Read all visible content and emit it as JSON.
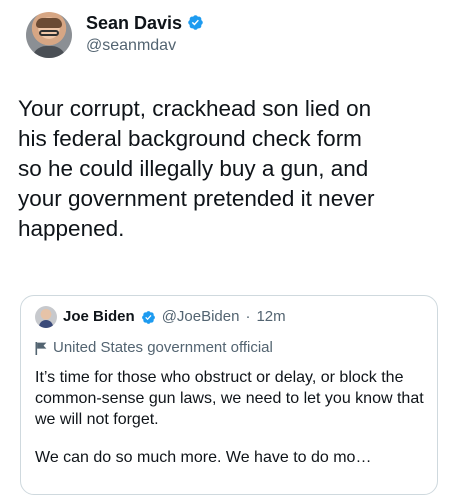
{
  "tweet": {
    "author": {
      "display_name": "Sean Davis",
      "handle": "@seanmdav",
      "verified": true
    },
    "text": "Your corrupt, crackhead son lied on\nhis federal background check form\nso he could illegally buy a gun, and\nyour government pretended it never\nhappened."
  },
  "quoted_tweet": {
    "author": {
      "display_name": "Joe Biden",
      "handle": "@JoeBiden",
      "verified": true
    },
    "separator": "·",
    "time": "12m",
    "account_label": "United States government official",
    "paragraphs": [
      "It’s time for those who obstruct or delay, or block the common-sense gun laws, we need to let you know that we will not forget.",
      "We can do so much more. We have to do mo…"
    ]
  },
  "colors": {
    "verified": "#1d9bf0",
    "secondary_text": "#536471",
    "border": "#cfd9de"
  },
  "icons": {
    "verified": "verified-badge-icon",
    "government": "flag-icon"
  }
}
